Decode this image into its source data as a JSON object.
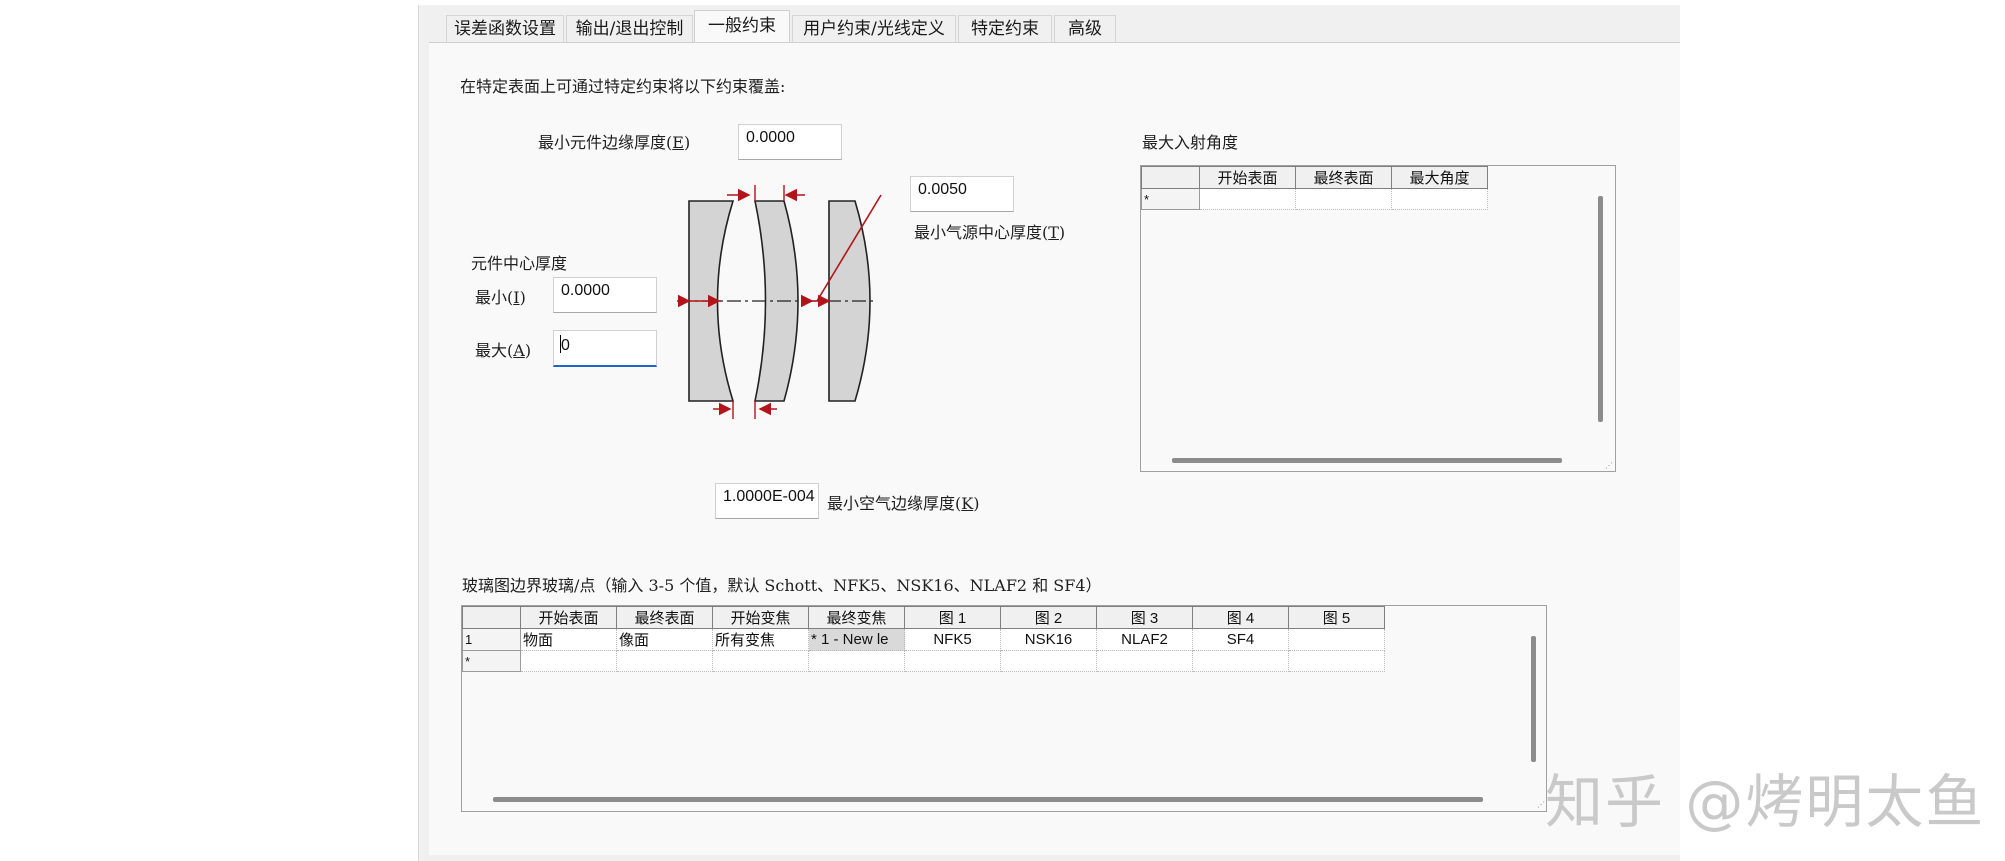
{
  "tabs": [
    {
      "label": "误差函数设置"
    },
    {
      "label": "输出/退出控制"
    },
    {
      "label": "一般约束"
    },
    {
      "label": "用户约束/光线定义"
    },
    {
      "label": "特定约束"
    },
    {
      "label": "高级"
    }
  ],
  "intro_text": "在特定表面上可通过特定约束将以下约束覆盖:",
  "min_edge_thickness": {
    "label": "最小元件边缘厚度(",
    "key": "E",
    "close": ")",
    "value": "0.0000"
  },
  "min_air_center": {
    "label": "最小气源中心厚度(",
    "key": "T",
    "close": ")",
    "value": "0.0050"
  },
  "center_thickness": {
    "group_label": "元件中心厚度",
    "min_label": "最小(",
    "min_key": "I",
    "min_close": ")",
    "min_value": "0.0000",
    "max_label": "最大(",
    "max_key": "A",
    "max_close": ")",
    "max_value": "0"
  },
  "min_air_edge": {
    "label": "最小空气边缘厚度(",
    "key": "K",
    "close": ")",
    "value": "1.0000E-004"
  },
  "max_incidence": {
    "label": "最大入射角度",
    "headers": [
      "开始表面",
      "最终表面",
      "最大角度"
    ],
    "new_row_marker": "*"
  },
  "glass_boundary": {
    "label": "玻璃图边界玻璃/点（输入 3-5 个值，默认 Schott、NFK5、NSK16、NLAF2 和 SF4）",
    "headers": [
      "开始表面",
      "最终表面",
      "开始变焦",
      "最终变焦",
      "图 1",
      "图 2",
      "图 3",
      "图 4",
      "图 5"
    ],
    "rows": [
      {
        "index": "1",
        "cells": [
          "物面",
          "像面",
          "所有变焦",
          "* 1 - New le",
          "NFK5",
          "NSK16",
          "NLAF2",
          "SF4",
          ""
        ]
      }
    ],
    "new_row_marker": "*"
  },
  "watermark": "知乎 @烤明太鱼"
}
